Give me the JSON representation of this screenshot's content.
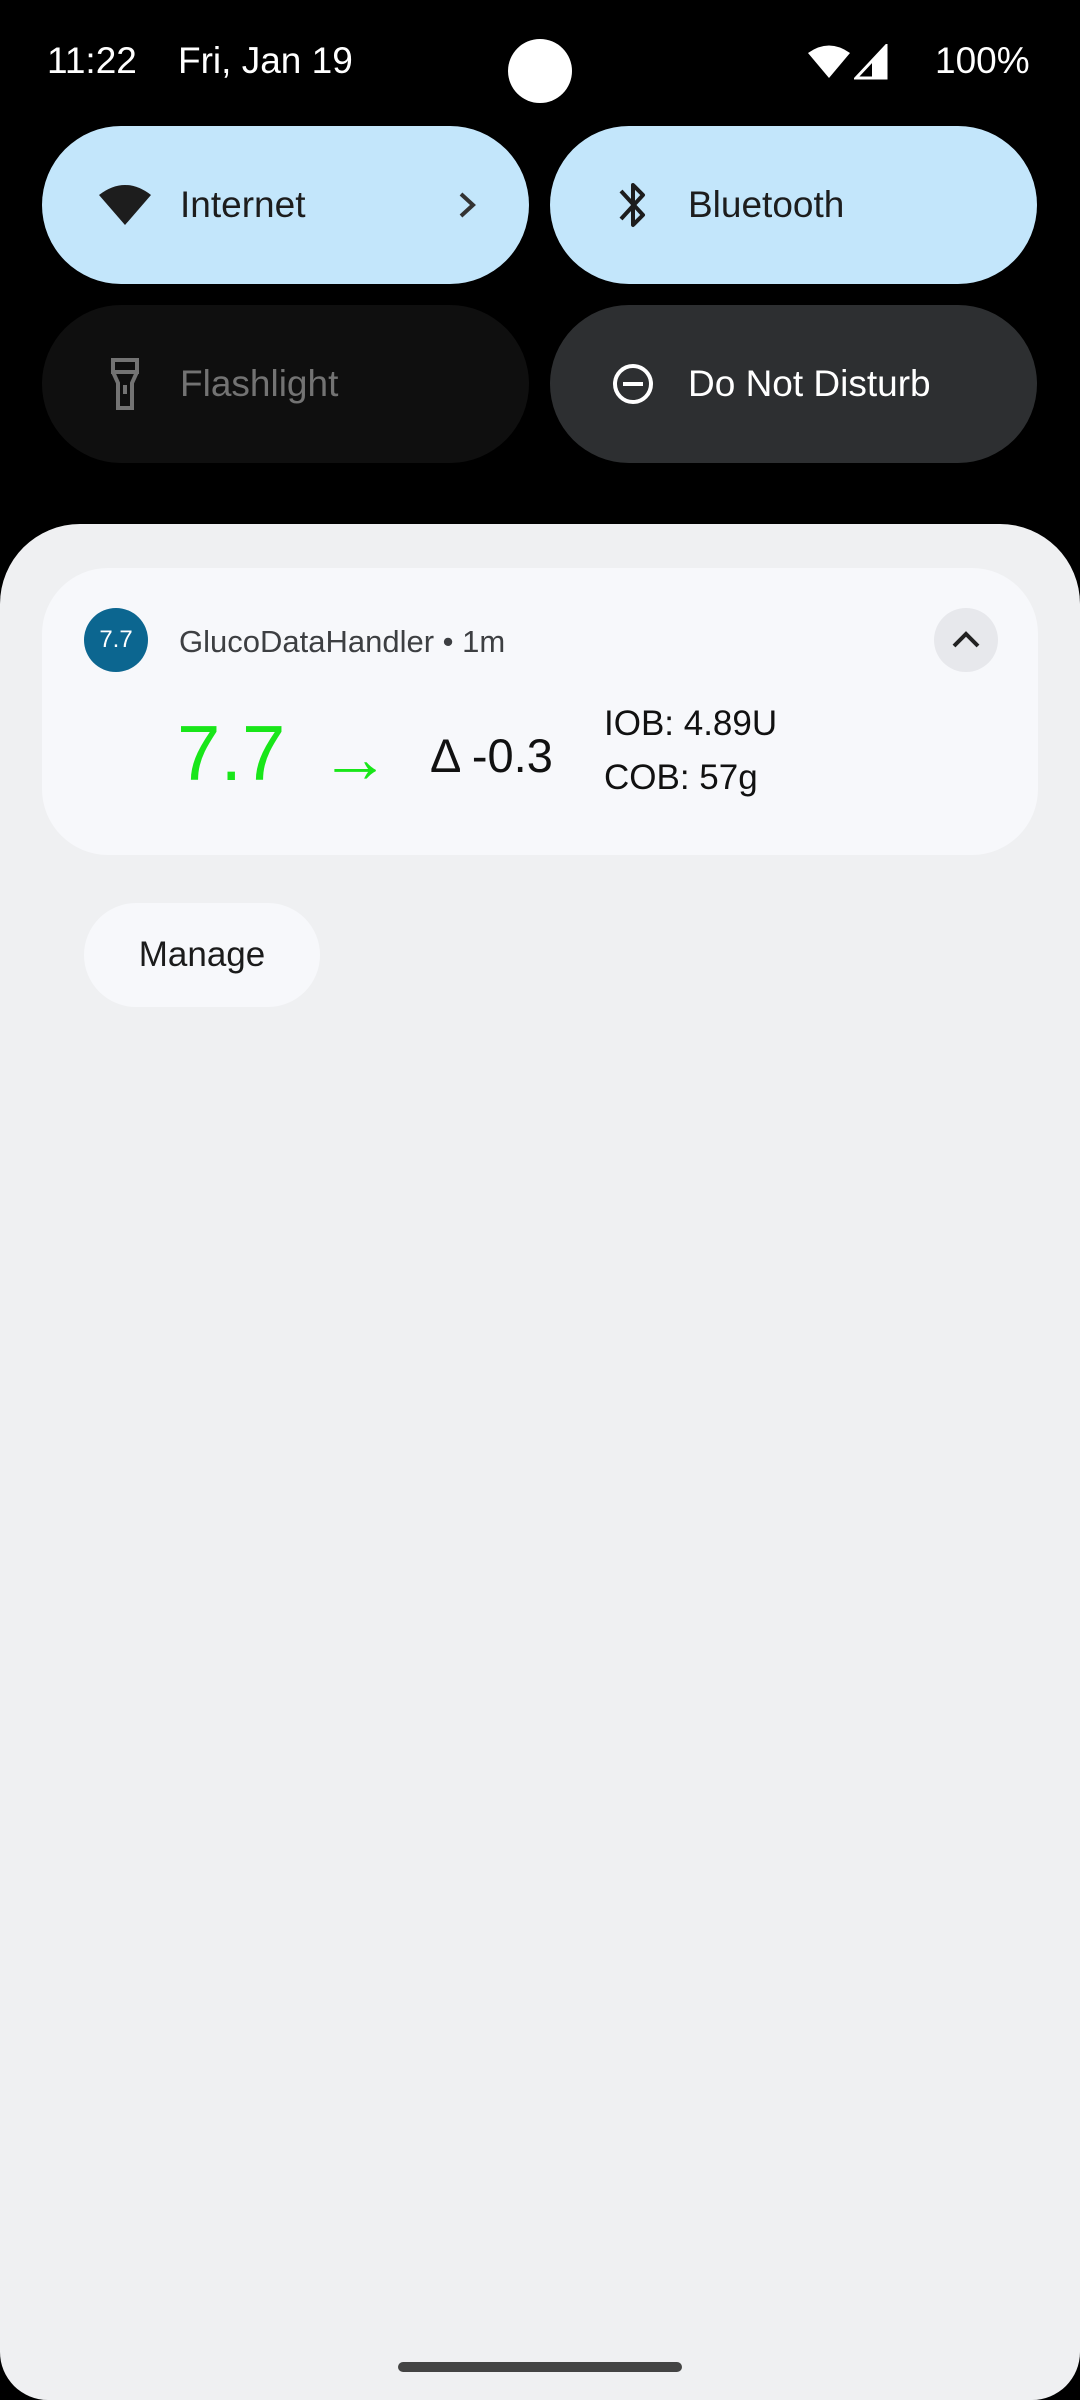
{
  "status_bar": {
    "time": "11:22",
    "date": "Fri, Jan 19",
    "battery": "100%",
    "icons": [
      "wifi-icon",
      "cell-signal-icon"
    ]
  },
  "quick_settings": {
    "tiles": [
      {
        "label": "Internet",
        "icon": "wifi-icon",
        "state": "on"
      },
      {
        "label": "Bluetooth",
        "icon": "bluetooth-icon",
        "state": "on"
      },
      {
        "label": "Flashlight",
        "icon": "flashlight-icon",
        "state": "unavailable"
      },
      {
        "label": "Do Not Disturb",
        "icon": "do-not-disturb-icon",
        "state": "off"
      }
    ]
  },
  "notification": {
    "app_icon_text": "7.7",
    "app_name": "GlucoDataHandler",
    "separator": "•",
    "time": "1m",
    "glucose": "7.7",
    "trend_arrow": "→",
    "delta": "Δ -0.3",
    "iob": "IOB: 4.89U",
    "cob": "COB: 57g",
    "colors": {
      "glucose": "#19e619",
      "app_icon_bg": "#0c6690"
    }
  },
  "manage_label": "Manage",
  "colors": {
    "tile_active": "#c3e6fb",
    "tile_dark": "#2d2f31",
    "shade_bg": "#eff0f2"
  }
}
